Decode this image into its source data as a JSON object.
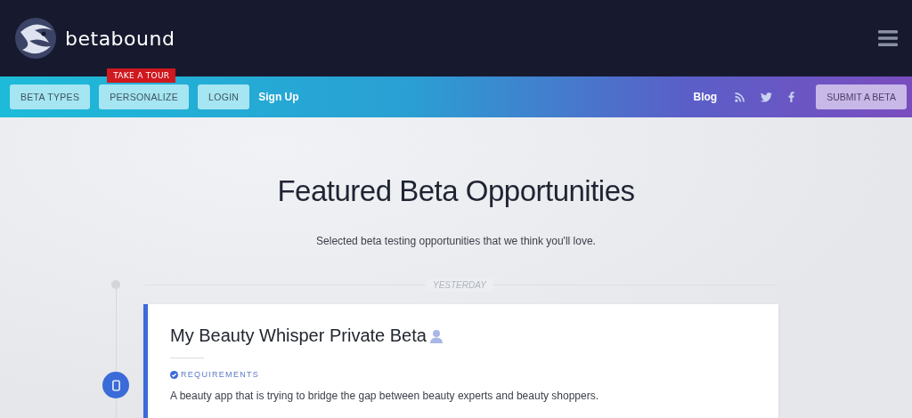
{
  "header": {
    "brand": "betabound"
  },
  "nav": {
    "tour_badge": "TAKE A TOUR",
    "buttons": [
      {
        "label": "BETA TYPES"
      },
      {
        "label": "PERSONALIZE"
      },
      {
        "label": "LOGIN"
      }
    ],
    "signup": "Sign Up",
    "blog": "Blog",
    "submit": "SUBMIT A BETA"
  },
  "hero": {
    "title": "Featured Beta Opportunities",
    "subtitle": "Selected beta testing opportunities that we think you'll love."
  },
  "timeline": {
    "date": "YESTERDAY",
    "card": {
      "title": "My Beauty Whisper Private Beta",
      "requirements": "REQUIREMENTS",
      "description": "A beauty app that is trying to bridge the gap between beauty experts and beauty shoppers."
    }
  }
}
